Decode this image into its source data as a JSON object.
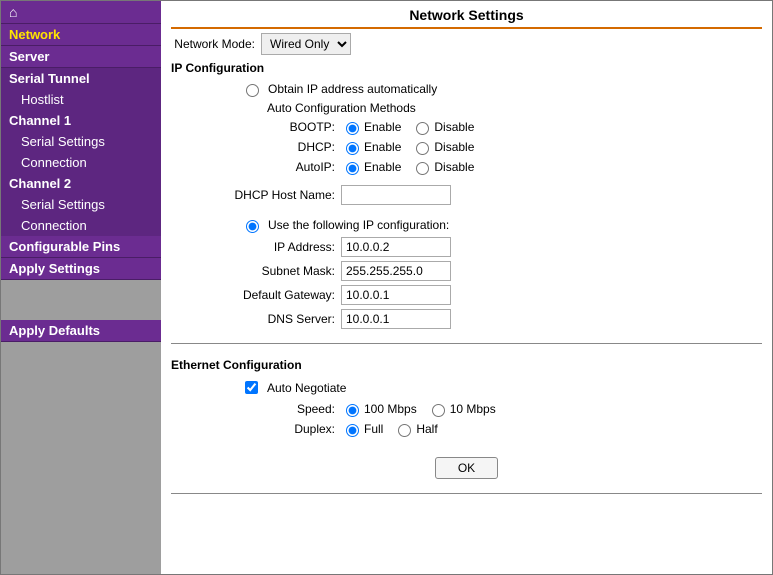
{
  "sidebar": {
    "home_icon": "⌂",
    "items": [
      {
        "label": "Network",
        "type": "head",
        "active": true
      },
      {
        "label": "Server",
        "type": "head"
      },
      {
        "label": "Serial Tunnel",
        "type": "parent"
      },
      {
        "label": "Hostlist",
        "type": "child"
      },
      {
        "label": "Channel 1",
        "type": "parent"
      },
      {
        "label": "Serial Settings",
        "type": "child"
      },
      {
        "label": "Connection",
        "type": "child"
      },
      {
        "label": "Channel 2",
        "type": "parent"
      },
      {
        "label": "Serial Settings",
        "type": "child"
      },
      {
        "label": "Connection",
        "type": "child"
      },
      {
        "label": "Configurable Pins",
        "type": "head"
      },
      {
        "label": "Apply Settings",
        "type": "head"
      }
    ],
    "apply_defaults": "Apply Defaults"
  },
  "page": {
    "title": "Network Settings",
    "network_mode": {
      "label": "Network Mode:",
      "value": "Wired Only"
    },
    "ip_config_title": "IP Configuration",
    "obtain_auto": "Obtain IP address automatically",
    "auto_methods_title": "Auto Configuration Methods",
    "methods": [
      {
        "name": "BOOTP:",
        "enable": "Enable",
        "disable": "Disable"
      },
      {
        "name": "DHCP:",
        "enable": "Enable",
        "disable": "Disable"
      },
      {
        "name": "AutoIP:",
        "enable": "Enable",
        "disable": "Disable"
      }
    ],
    "dhcp_host_label": "DHCP Host Name:",
    "dhcp_host_value": "",
    "use_following": "Use the following IP configuration:",
    "static": [
      {
        "label": "IP Address:",
        "value": "10.0.0.2"
      },
      {
        "label": "Subnet Mask:",
        "value": "255.255.255.0"
      },
      {
        "label": "Default Gateway:",
        "value": "10.0.0.1"
      },
      {
        "label": "DNS Server:",
        "value": "10.0.0.1"
      }
    ],
    "ethernet_title": "Ethernet Configuration",
    "auto_negotiate": "Auto Negotiate",
    "speed": {
      "label": "Speed:",
      "opt1": "100 Mbps",
      "opt2": "10 Mbps"
    },
    "duplex": {
      "label": "Duplex:",
      "opt1": "Full",
      "opt2": "Half"
    },
    "ok": "OK"
  }
}
